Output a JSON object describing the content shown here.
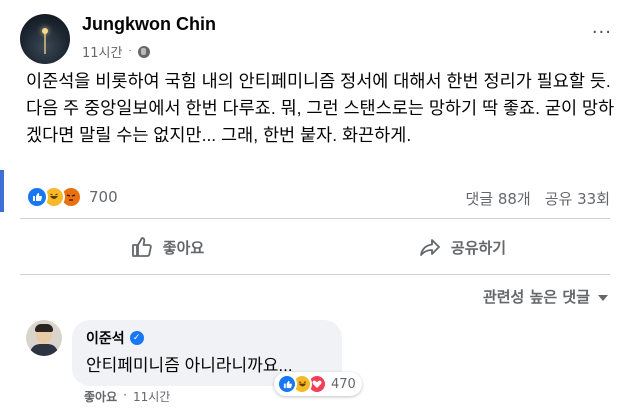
{
  "post": {
    "author": "Jungkwon Chin",
    "time": "11시간",
    "dot": "·",
    "more_label": "···",
    "text": "이준석을 비롯하여 국힘 내의 안티페미니즘  정서에 대해서 한번 정리가 필요할 듯. 다음 주 중앙일보에서 한번 다루죠. 뭐, 그런 스탠스로는 망하기  딱 좋죠. 굳이 망하겠다면 말릴 수는 없지만... 그래,  한번 붙자. 화끈하게."
  },
  "stats": {
    "reaction_icons": [
      "like-icon",
      "haha-icon",
      "angry-icon"
    ],
    "reaction_count": "700",
    "comments": "댓글 88개",
    "shares": "공유 33회"
  },
  "actions": {
    "like_label": "좋아요",
    "share_label": "공유하기"
  },
  "sort": {
    "label": "관련성 높은 댓글"
  },
  "comment": {
    "author": "이준석",
    "verified_icon": "verified-badge-icon",
    "text": "안티페미니즘 아니라니까요...",
    "reaction_icons": [
      "like-icon",
      "haha-icon",
      "love-icon"
    ],
    "reaction_count": "470",
    "like_link": "좋아요",
    "time": "11시간",
    "dot": "·"
  },
  "colors": {
    "accent": "#1877f2",
    "secondary_text": "#65676b",
    "bubble": "#f0f2f5"
  }
}
